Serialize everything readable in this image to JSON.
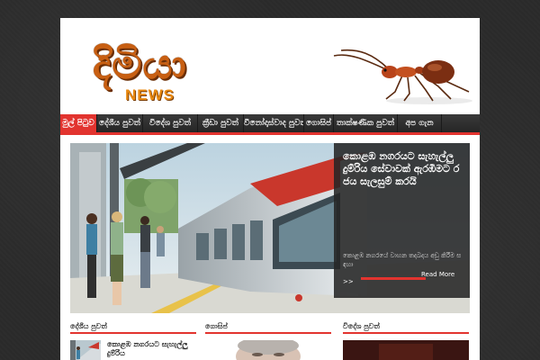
{
  "logo": {
    "sinhala": "දිමියා",
    "news": "NEWS"
  },
  "nav": {
    "items": [
      {
        "label": "මුල් පිටුව"
      },
      {
        "label": "දේශීය පුවත්"
      },
      {
        "label": "විදේශ පුවත්"
      },
      {
        "label": "ක්‍රීඩා පුවත්"
      },
      {
        "label": "විනෝදාස්වාද පුවත්"
      },
      {
        "label": "ගොසිප්"
      },
      {
        "label": "තාක්ෂණික පුවත්"
      },
      {
        "label": "අප ගැන"
      }
    ]
  },
  "slider": {
    "title": "කොළඹ නගරයට සැහැල්ලු දුම්රිය සේවාවක් ඇරඹීමට රජය සැලසුම් කරයි",
    "excerpt": "කොළඹ නගරයේ වාහන තදබදය අඩු කිරීම සඳහා",
    "arrow": ">>",
    "read_more": "Read More"
  },
  "sections": [
    {
      "title": "දේශීය පුවත්",
      "item_title": "කොළඹ නගරයට සැහැල්ලු දුම්රිය"
    },
    {
      "title": "ගොසිප්"
    },
    {
      "title": "විදේශ පුවත්"
    }
  ]
}
